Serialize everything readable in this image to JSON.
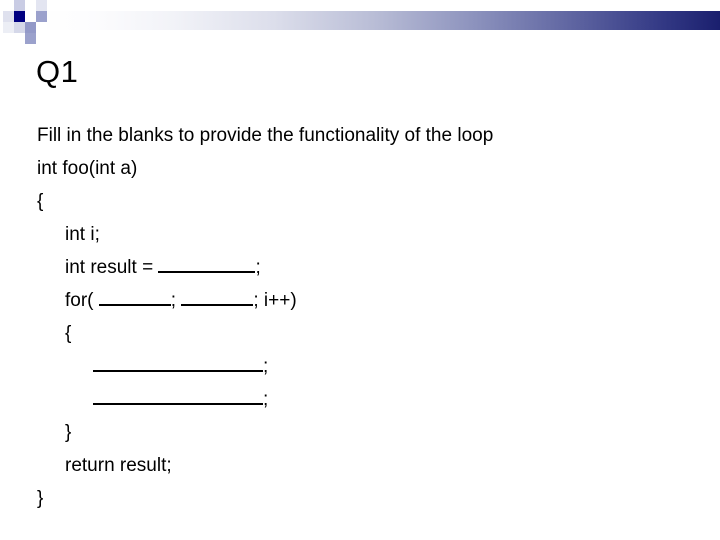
{
  "slide": {
    "title": "Q1",
    "decor": {
      "squares_accent_color": "#000080",
      "bar_gradient_from": "#ffffff",
      "bar_gradient_to": "#1a1f6e"
    },
    "body": {
      "prompt": "Fill in the blanks to provide the functionality of the loop",
      "code_lines": [
        {
          "indent": 0,
          "segments": [
            {
              "type": "text",
              "value": "int foo(int a)"
            }
          ]
        },
        {
          "indent": 0,
          "segments": [
            {
              "type": "text",
              "value": "{"
            }
          ]
        },
        {
          "indent": 1,
          "segments": [
            {
              "type": "text",
              "value": "int i;"
            }
          ]
        },
        {
          "indent": 1,
          "segments": [
            {
              "type": "text",
              "value": "int result = "
            },
            {
              "type": "blank",
              "value": "_______"
            },
            {
              "type": "text",
              "value": ";"
            }
          ]
        },
        {
          "indent": 1,
          "segments": [
            {
              "type": "text",
              "value": "for( "
            },
            {
              "type": "blank",
              "value": "_____"
            },
            {
              "type": "text",
              "value": "; "
            },
            {
              "type": "blank",
              "value": "_____"
            },
            {
              "type": "text",
              "value": "; i++)"
            }
          ]
        },
        {
          "indent": 1,
          "segments": [
            {
              "type": "text",
              "value": "{"
            }
          ]
        },
        {
          "indent": 2,
          "segments": [
            {
              "type": "blank",
              "value": "__________"
            },
            {
              "type": "text",
              "value": ";"
            }
          ]
        },
        {
          "indent": 2,
          "segments": [
            {
              "type": "blank",
              "value": "__________"
            },
            {
              "type": "text",
              "value": ";"
            }
          ]
        },
        {
          "indent": 1,
          "segments": [
            {
              "type": "text",
              "value": "}"
            }
          ]
        },
        {
          "indent": 1,
          "segments": [
            {
              "type": "text",
              "value": "return result;"
            }
          ]
        },
        {
          "indent": 0,
          "segments": [
            {
              "type": "text",
              "value": "}"
            }
          ]
        }
      ],
      "line_texts": [
        "int foo(int a)",
        "{",
        "int i;",
        "int result = _______;",
        "for( _____; _____; i++)",
        "{",
        "__________;",
        "__________;",
        "}",
        "return result;",
        "}"
      ]
    }
  }
}
